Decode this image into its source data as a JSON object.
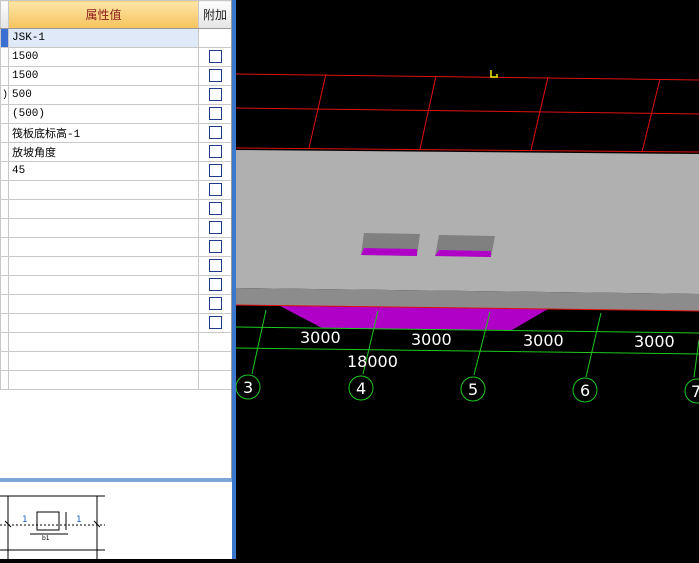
{
  "property_grid": {
    "header_value": "属性值",
    "header_add": "附加",
    "rows": [
      {
        "stub": "",
        "value": "JSK-1",
        "has_checkbox": false
      },
      {
        "stub": "",
        "value": "1500",
        "has_checkbox": true
      },
      {
        "stub": "",
        "value": "1500",
        "has_checkbox": true
      },
      {
        "stub": ")",
        "value": "500",
        "has_checkbox": true
      },
      {
        "stub": "",
        "value": "(500)",
        "has_checkbox": true
      },
      {
        "stub": "",
        "value": "筏板底标高-1",
        "has_checkbox": true
      },
      {
        "stub": "",
        "value": "放坡角度",
        "has_checkbox": true
      },
      {
        "stub": "",
        "value": "45",
        "has_checkbox": true
      },
      {
        "stub": "",
        "value": "",
        "has_checkbox": true
      },
      {
        "stub": "",
        "value": "",
        "has_checkbox": true
      },
      {
        "stub": "",
        "value": "",
        "has_checkbox": true
      },
      {
        "stub": "",
        "value": "",
        "has_checkbox": true
      },
      {
        "stub": "",
        "value": "",
        "has_checkbox": true
      },
      {
        "stub": "",
        "value": "",
        "has_checkbox": true
      },
      {
        "stub": "",
        "value": "",
        "has_checkbox": true
      },
      {
        "stub": "",
        "value": "",
        "has_checkbox": true
      },
      {
        "stub": "",
        "value": "",
        "has_checkbox": false
      },
      {
        "stub": "",
        "value": "",
        "has_checkbox": false
      },
      {
        "stub": "",
        "value": "",
        "has_checkbox": false
      }
    ]
  },
  "mini_drawing": {
    "left_label": "1",
    "right_label": "1",
    "dim_label": "b1"
  },
  "viewport": {
    "dimensions": [
      "3000",
      "3000",
      "3000",
      "3000"
    ],
    "total_dimension": "18000",
    "axes": [
      "3",
      "4",
      "5",
      "6",
      "7"
    ]
  },
  "colors": {
    "grid_line": "#e01010",
    "axis_line": "#1ec81e",
    "slab": "#b0b0b0",
    "pit": "#b000c8",
    "marker": "#f0f000"
  }
}
